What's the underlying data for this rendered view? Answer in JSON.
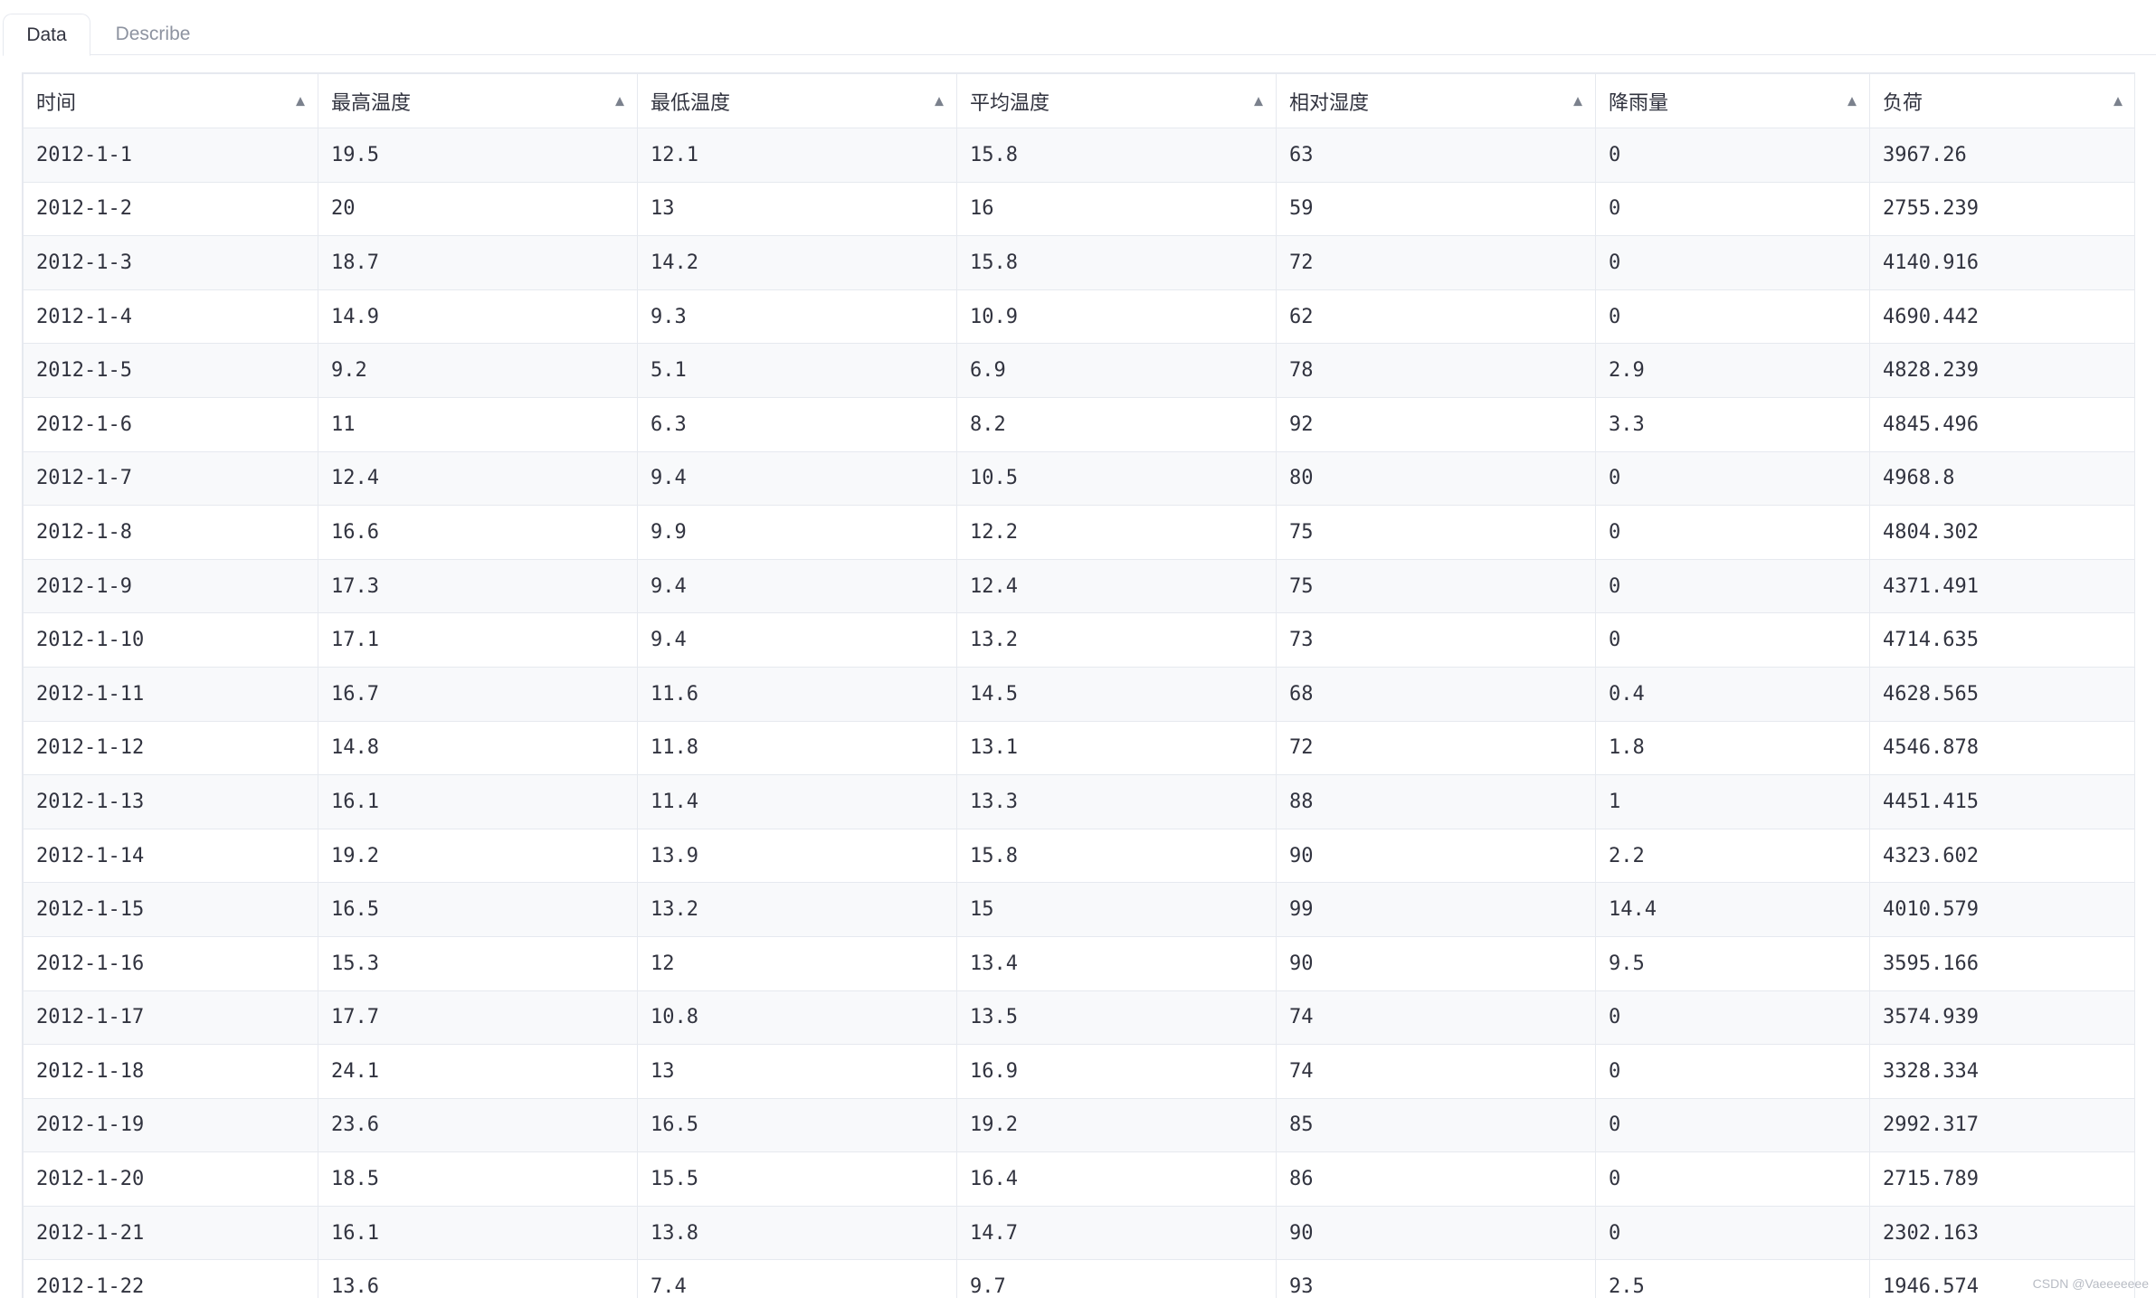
{
  "tabs": [
    {
      "label": "Data",
      "active": true
    },
    {
      "label": "Describe",
      "active": false
    }
  ],
  "table": {
    "columns": [
      "时间",
      "最高温度",
      "最低温度",
      "平均温度",
      "相对湿度",
      "降雨量",
      "负荷"
    ],
    "sort_icon": "triangle-up-icon",
    "rows": [
      [
        "2012-1-1",
        "19.5",
        "12.1",
        "15.8",
        "63",
        "0",
        "3967.26"
      ],
      [
        "2012-1-2",
        "20",
        "13",
        "16",
        "59",
        "0",
        "2755.239"
      ],
      [
        "2012-1-3",
        "18.7",
        "14.2",
        "15.8",
        "72",
        "0",
        "4140.916"
      ],
      [
        "2012-1-4",
        "14.9",
        "9.3",
        "10.9",
        "62",
        "0",
        "4690.442"
      ],
      [
        "2012-1-5",
        "9.2",
        "5.1",
        "6.9",
        "78",
        "2.9",
        "4828.239"
      ],
      [
        "2012-1-6",
        "11",
        "6.3",
        "8.2",
        "92",
        "3.3",
        "4845.496"
      ],
      [
        "2012-1-7",
        "12.4",
        "9.4",
        "10.5",
        "80",
        "0",
        "4968.8"
      ],
      [
        "2012-1-8",
        "16.6",
        "9.9",
        "12.2",
        "75",
        "0",
        "4804.302"
      ],
      [
        "2012-1-9",
        "17.3",
        "9.4",
        "12.4",
        "75",
        "0",
        "4371.491"
      ],
      [
        "2012-1-10",
        "17.1",
        "9.4",
        "13.2",
        "73",
        "0",
        "4714.635"
      ],
      [
        "2012-1-11",
        "16.7",
        "11.6",
        "14.5",
        "68",
        "0.4",
        "4628.565"
      ],
      [
        "2012-1-12",
        "14.8",
        "11.8",
        "13.1",
        "72",
        "1.8",
        "4546.878"
      ],
      [
        "2012-1-13",
        "16.1",
        "11.4",
        "13.3",
        "88",
        "1",
        "4451.415"
      ],
      [
        "2012-1-14",
        "19.2",
        "13.9",
        "15.8",
        "90",
        "2.2",
        "4323.602"
      ],
      [
        "2012-1-15",
        "16.5",
        "13.2",
        "15",
        "99",
        "14.4",
        "4010.579"
      ],
      [
        "2012-1-16",
        "15.3",
        "12",
        "13.4",
        "90",
        "9.5",
        "3595.166"
      ],
      [
        "2012-1-17",
        "17.7",
        "10.8",
        "13.5",
        "74",
        "0",
        "3574.939"
      ],
      [
        "2012-1-18",
        "24.1",
        "13",
        "16.9",
        "74",
        "0",
        "3328.334"
      ],
      [
        "2012-1-19",
        "23.6",
        "16.5",
        "19.2",
        "85",
        "0",
        "2992.317"
      ],
      [
        "2012-1-20",
        "18.5",
        "15.5",
        "16.4",
        "86",
        "0",
        "2715.789"
      ],
      [
        "2012-1-21",
        "16.1",
        "13.8",
        "14.7",
        "90",
        "0",
        "2302.163"
      ],
      [
        "2012-1-22",
        "13.6",
        "7.4",
        "9.7",
        "93",
        "2.5",
        "1946.574"
      ]
    ]
  },
  "watermark": "CSDN @Vaeeeeeee"
}
